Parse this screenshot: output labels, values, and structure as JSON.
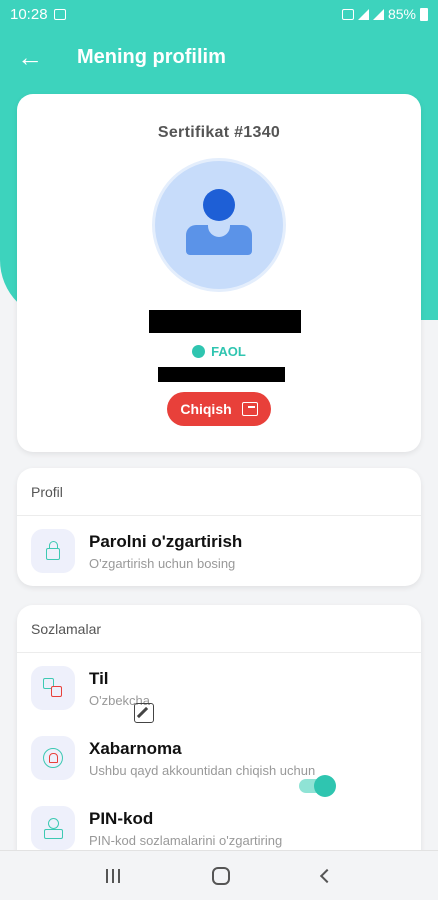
{
  "status_bar": {
    "time": "10:28",
    "battery": "85%"
  },
  "header": {
    "title": "Mening profilim"
  },
  "profile": {
    "certificate": "Sertifikat #1340",
    "status": "FAOL",
    "logout_label": "Chiqish"
  },
  "profile_section": {
    "header": "Profil",
    "items": [
      {
        "title": "Parolni o'zgartirish",
        "subtitle": "O'zgartirish uchun bosing"
      }
    ]
  },
  "settings_section": {
    "header": "Sozlamalar",
    "items": [
      {
        "title": "Til",
        "subtitle": "O'zbekcha"
      },
      {
        "title": "Xabarnoma",
        "subtitle": "Ushbu qayd akkountidan chiqish uchun",
        "toggle_on": true
      },
      {
        "title": "PIN-kod",
        "subtitle": "PIN-kod sozlamalarini o'zgartiring"
      }
    ]
  },
  "colors": {
    "accent": "#3dd3bd",
    "danger": "#e8403a",
    "status": "#2fc5b0"
  }
}
